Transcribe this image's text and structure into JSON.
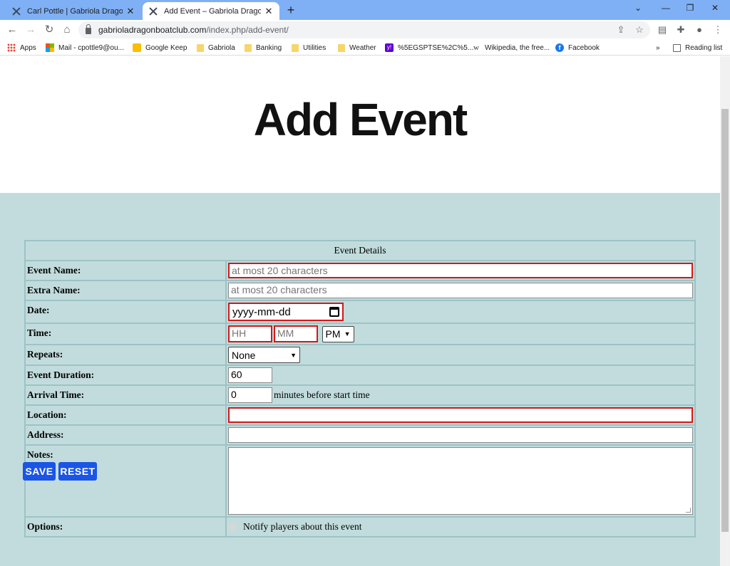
{
  "browser": {
    "tabs": [
      {
        "title": "Carl Pottle | Gabriola Dragon Boa",
        "active": false
      },
      {
        "title": "Add Event – Gabriola Dragon Boa",
        "active": true
      }
    ],
    "url_domain": "gabrioladragonboatclub.com",
    "url_path": "/index.php/add-event/",
    "bookmarks": [
      {
        "label": "Apps",
        "icon": "apps-grid-icon"
      },
      {
        "label": "Mail - cpottle9@ou...",
        "icon": "microsoft-icon"
      },
      {
        "label": "Google Keep",
        "icon": "google-keep-icon"
      },
      {
        "label": "Gabriola",
        "icon": "folder-icon"
      },
      {
        "label": "Banking",
        "icon": "folder-icon"
      },
      {
        "label": "Utilities",
        "icon": "folder-icon"
      },
      {
        "label": "Weather",
        "icon": "folder-icon"
      },
      {
        "label": "%5EGSPTSE%2C%5...",
        "icon": "yahoo-icon"
      },
      {
        "label": "Wikipedia, the free...",
        "icon": "wikipedia-icon"
      },
      {
        "label": "Facebook",
        "icon": "facebook-icon"
      }
    ],
    "overflow": "»",
    "reading_list": "Reading list"
  },
  "page": {
    "title": "Add Event",
    "form": {
      "header": "Event Details",
      "event_name": {
        "label": "Event Name:",
        "placeholder": "at most 20 characters"
      },
      "extra_name": {
        "label": "Extra Name:",
        "placeholder": "at most 20 characters"
      },
      "date": {
        "label": "Date:",
        "placeholder": "yyyy-mm-dd"
      },
      "time": {
        "label": "Time:",
        "hour_placeholder": "HH",
        "minute_placeholder": "MM",
        "ampm": "PM"
      },
      "repeats": {
        "label": "Repeats:",
        "value": "None"
      },
      "duration": {
        "label": "Event Duration:",
        "value": "60"
      },
      "arrival": {
        "label": "Arrival Time:",
        "value": "0",
        "suffix": "minutes before start time"
      },
      "location": {
        "label": "Location:"
      },
      "address": {
        "label": "Address:"
      },
      "notes": {
        "label": "Notes:"
      },
      "options": {
        "label": "Options:",
        "notify": "Notify players about this event"
      }
    },
    "buttons": {
      "save": "SAVE",
      "reset": "RESET"
    }
  },
  "colors": {
    "tabstrip": "#7fb0f5",
    "content_bg": "#c2dcdd",
    "required_border": "#d21818",
    "button": "#1a55e6"
  }
}
